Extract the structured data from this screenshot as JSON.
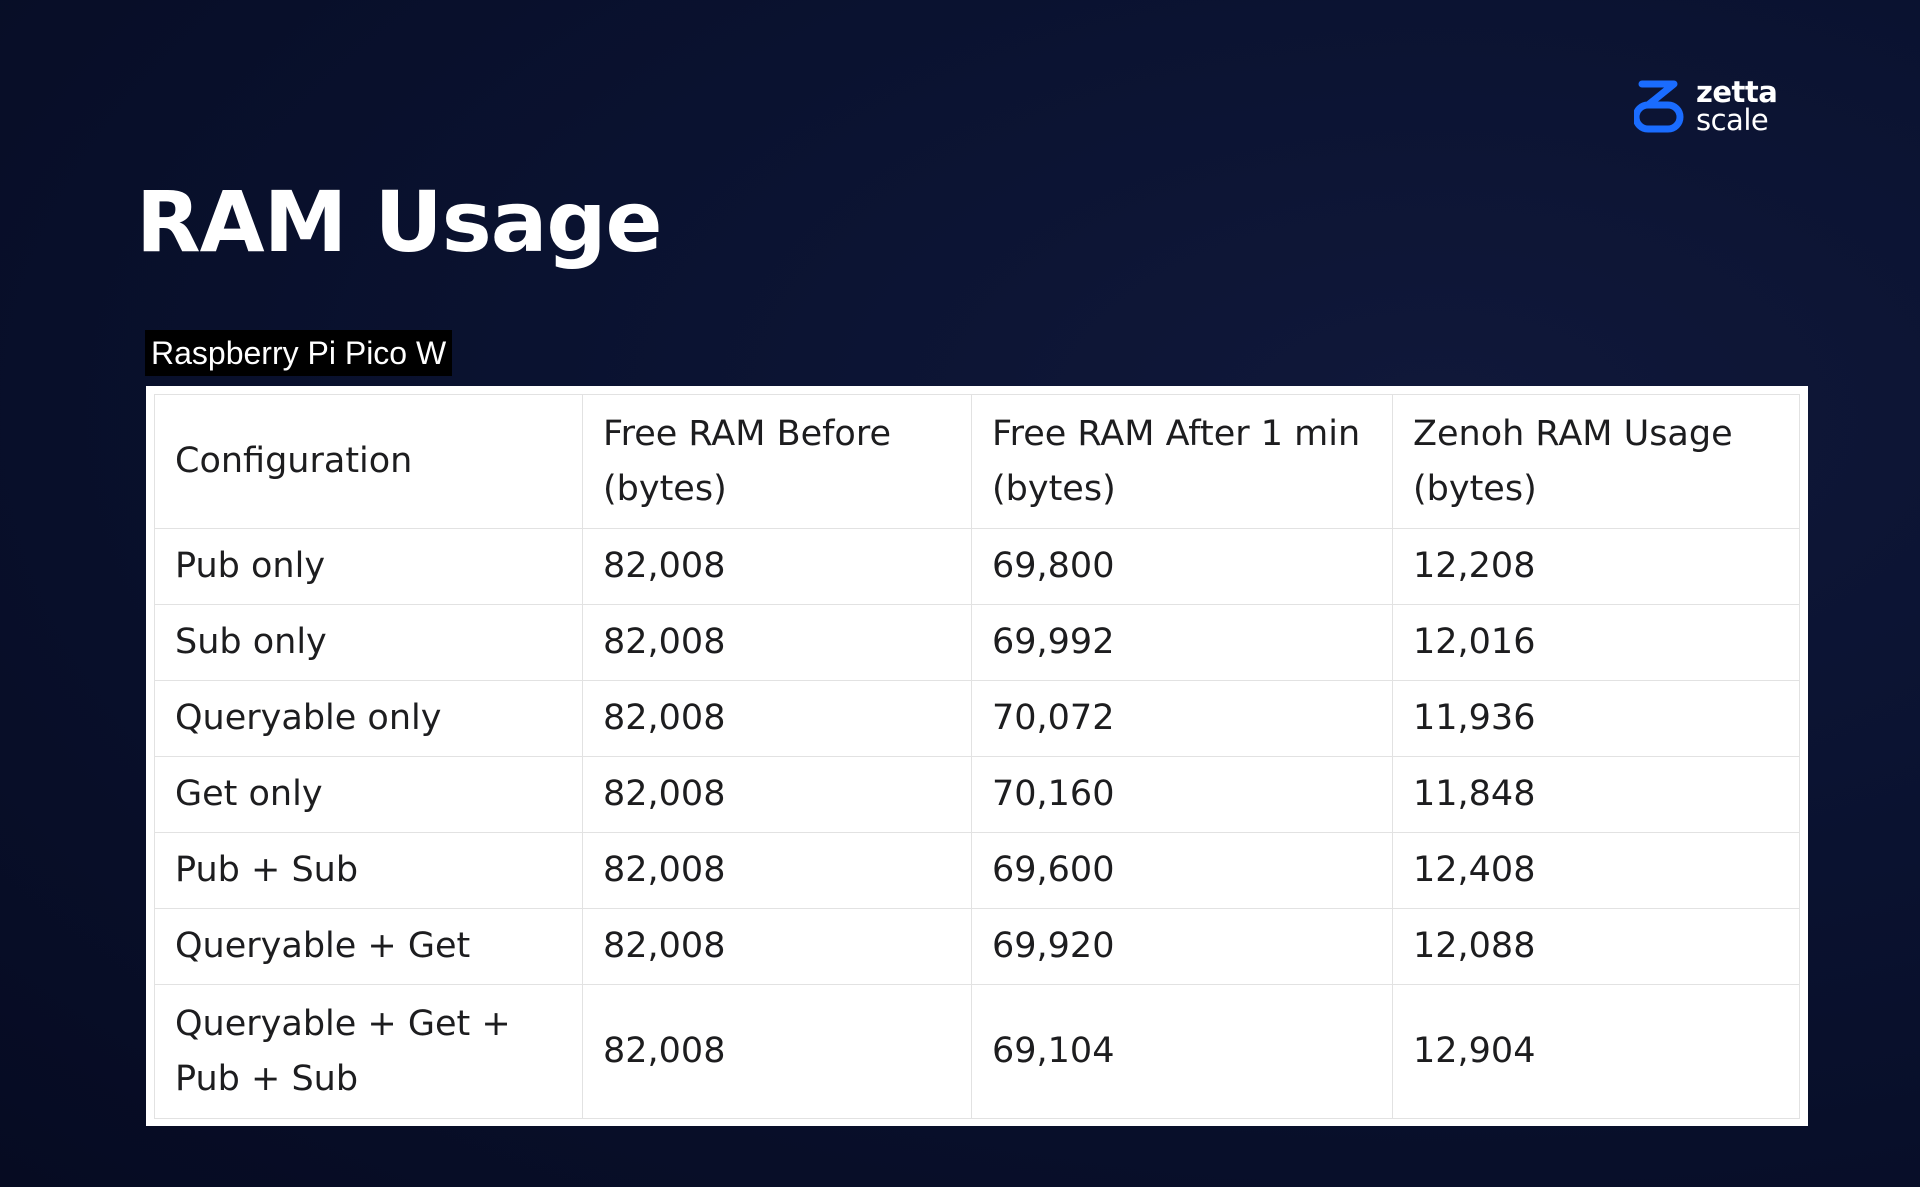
{
  "brand": {
    "logo_line1": "zetta",
    "logo_line2": "scale",
    "accent_color": "#1a6cff"
  },
  "slide": {
    "title": "RAM Usage",
    "caption": "Raspberry Pi Pico W"
  },
  "table": {
    "headers": [
      "Configuration",
      "Free RAM Before (bytes)",
      "Free RAM After 1 min (bytes)",
      "Zenoh RAM Usage (bytes)"
    ],
    "rows": [
      [
        "Pub only",
        "82,008",
        "69,800",
        "12,208"
      ],
      [
        "Sub only",
        "82,008",
        "69,992",
        "12,016"
      ],
      [
        "Queryable only",
        "82,008",
        "70,072",
        "11,936"
      ],
      [
        "Get only",
        "82,008",
        "70,160",
        "11,848"
      ],
      [
        "Pub + Sub",
        "82,008",
        "69,600",
        "12,408"
      ],
      [
        "Queryable + Get",
        "82,008",
        "69,920",
        "12,088"
      ],
      [
        "Queryable + Get + Pub + Sub",
        "82,008",
        "69,104",
        "12,904"
      ]
    ]
  }
}
